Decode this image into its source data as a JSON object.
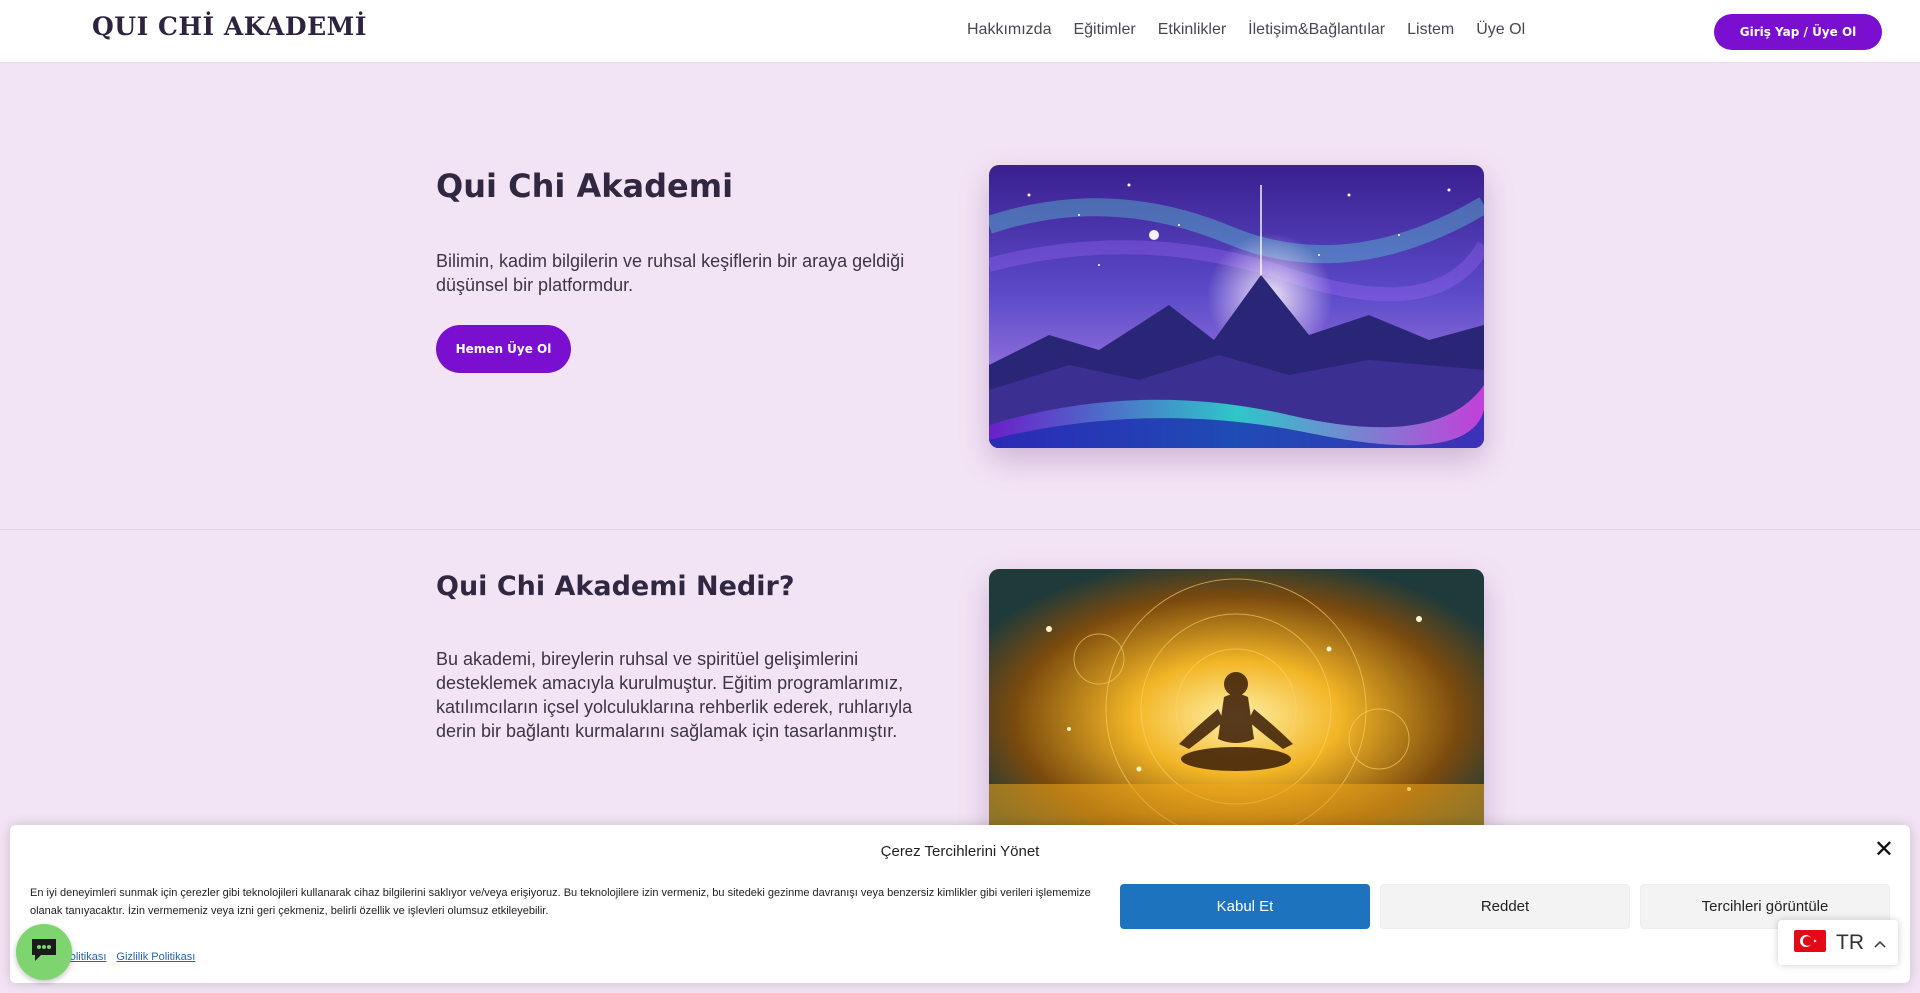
{
  "header": {
    "logo": "QUI CHİ AKADEMİ",
    "nav": [
      "Hakkımızda",
      "Eğitimler",
      "Etkinlikler",
      "İletişim&Bağlantılar",
      "Listem",
      "Üye Ol"
    ],
    "login_label": "Giriş Yap / Üye Ol"
  },
  "hero": {
    "title": "Qui Chi Akademi",
    "text": "Bilimin, kadim bilgilerin ve ruhsal keşiflerin bir araya geldiği düşünsel bir platformdur.",
    "cta": "Hemen Üye Ol"
  },
  "about": {
    "title": "Qui Chi Akademi Nedir?",
    "text": "Bu akademi, bireylerin ruhsal ve spiritüel gelişimlerini desteklemek amacıyla kurulmuştur. Eğitim programlarımız, katılımcıların içsel yolculuklarına rehberlik ederek, ruhlarıyla derin bir bağlantı kurmalarını sağlamak için tasarlanmıştır."
  },
  "cookie": {
    "title": "Çerez Tercihlerini Yönet",
    "text": "En iyi deneyimleri sunmak için çerezler gibi teknolojileri kullanarak cihaz bilgilerini saklıyor ve/veya erişiyoruz. Bu teknolojilere izin vermeniz, bu sitedeki gezinme davranışı veya benzersiz kimlikler gibi verileri işlememize olanak tanıyacaktır. İzin vermemeniz veya izni geri çekmeniz, belirli özellik ve işlevleri olumsuz etkileyebilir.",
    "accept": "Kabul Et",
    "deny": "Reddet",
    "prefs": "Tercihleri görüntüle",
    "link_cookie": "Çerez Politikası",
    "link_privacy": "Gizlilik Politikası"
  },
  "language": {
    "code": "TR"
  },
  "colors": {
    "accent": "#7a0fd0",
    "page_bg": "#f3e4f5",
    "accept_blue": "#1e73be",
    "chat_green": "#7ed56f"
  }
}
